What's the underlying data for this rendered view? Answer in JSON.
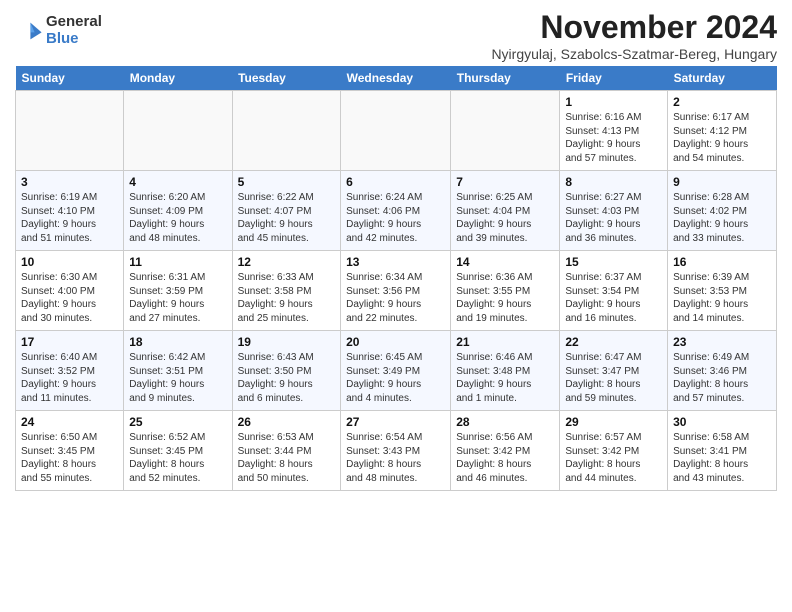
{
  "logo": {
    "general": "General",
    "blue": "Blue"
  },
  "title": "November 2024",
  "location": "Nyirgyulaj, Szabolcs-Szatmar-Bereg, Hungary",
  "headers": [
    "Sunday",
    "Monday",
    "Tuesday",
    "Wednesday",
    "Thursday",
    "Friday",
    "Saturday"
  ],
  "weeks": [
    [
      {
        "day": "",
        "detail": ""
      },
      {
        "day": "",
        "detail": ""
      },
      {
        "day": "",
        "detail": ""
      },
      {
        "day": "",
        "detail": ""
      },
      {
        "day": "",
        "detail": ""
      },
      {
        "day": "1",
        "detail": "Sunrise: 6:16 AM\nSunset: 4:13 PM\nDaylight: 9 hours\nand 57 minutes."
      },
      {
        "day": "2",
        "detail": "Sunrise: 6:17 AM\nSunset: 4:12 PM\nDaylight: 9 hours\nand 54 minutes."
      }
    ],
    [
      {
        "day": "3",
        "detail": "Sunrise: 6:19 AM\nSunset: 4:10 PM\nDaylight: 9 hours\nand 51 minutes."
      },
      {
        "day": "4",
        "detail": "Sunrise: 6:20 AM\nSunset: 4:09 PM\nDaylight: 9 hours\nand 48 minutes."
      },
      {
        "day": "5",
        "detail": "Sunrise: 6:22 AM\nSunset: 4:07 PM\nDaylight: 9 hours\nand 45 minutes."
      },
      {
        "day": "6",
        "detail": "Sunrise: 6:24 AM\nSunset: 4:06 PM\nDaylight: 9 hours\nand 42 minutes."
      },
      {
        "day": "7",
        "detail": "Sunrise: 6:25 AM\nSunset: 4:04 PM\nDaylight: 9 hours\nand 39 minutes."
      },
      {
        "day": "8",
        "detail": "Sunrise: 6:27 AM\nSunset: 4:03 PM\nDaylight: 9 hours\nand 36 minutes."
      },
      {
        "day": "9",
        "detail": "Sunrise: 6:28 AM\nSunset: 4:02 PM\nDaylight: 9 hours\nand 33 minutes."
      }
    ],
    [
      {
        "day": "10",
        "detail": "Sunrise: 6:30 AM\nSunset: 4:00 PM\nDaylight: 9 hours\nand 30 minutes."
      },
      {
        "day": "11",
        "detail": "Sunrise: 6:31 AM\nSunset: 3:59 PM\nDaylight: 9 hours\nand 27 minutes."
      },
      {
        "day": "12",
        "detail": "Sunrise: 6:33 AM\nSunset: 3:58 PM\nDaylight: 9 hours\nand 25 minutes."
      },
      {
        "day": "13",
        "detail": "Sunrise: 6:34 AM\nSunset: 3:56 PM\nDaylight: 9 hours\nand 22 minutes."
      },
      {
        "day": "14",
        "detail": "Sunrise: 6:36 AM\nSunset: 3:55 PM\nDaylight: 9 hours\nand 19 minutes."
      },
      {
        "day": "15",
        "detail": "Sunrise: 6:37 AM\nSunset: 3:54 PM\nDaylight: 9 hours\nand 16 minutes."
      },
      {
        "day": "16",
        "detail": "Sunrise: 6:39 AM\nSunset: 3:53 PM\nDaylight: 9 hours\nand 14 minutes."
      }
    ],
    [
      {
        "day": "17",
        "detail": "Sunrise: 6:40 AM\nSunset: 3:52 PM\nDaylight: 9 hours\nand 11 minutes."
      },
      {
        "day": "18",
        "detail": "Sunrise: 6:42 AM\nSunset: 3:51 PM\nDaylight: 9 hours\nand 9 minutes."
      },
      {
        "day": "19",
        "detail": "Sunrise: 6:43 AM\nSunset: 3:50 PM\nDaylight: 9 hours\nand 6 minutes."
      },
      {
        "day": "20",
        "detail": "Sunrise: 6:45 AM\nSunset: 3:49 PM\nDaylight: 9 hours\nand 4 minutes."
      },
      {
        "day": "21",
        "detail": "Sunrise: 6:46 AM\nSunset: 3:48 PM\nDaylight: 9 hours\nand 1 minute."
      },
      {
        "day": "22",
        "detail": "Sunrise: 6:47 AM\nSunset: 3:47 PM\nDaylight: 8 hours\nand 59 minutes."
      },
      {
        "day": "23",
        "detail": "Sunrise: 6:49 AM\nSunset: 3:46 PM\nDaylight: 8 hours\nand 57 minutes."
      }
    ],
    [
      {
        "day": "24",
        "detail": "Sunrise: 6:50 AM\nSunset: 3:45 PM\nDaylight: 8 hours\nand 55 minutes."
      },
      {
        "day": "25",
        "detail": "Sunrise: 6:52 AM\nSunset: 3:45 PM\nDaylight: 8 hours\nand 52 minutes."
      },
      {
        "day": "26",
        "detail": "Sunrise: 6:53 AM\nSunset: 3:44 PM\nDaylight: 8 hours\nand 50 minutes."
      },
      {
        "day": "27",
        "detail": "Sunrise: 6:54 AM\nSunset: 3:43 PM\nDaylight: 8 hours\nand 48 minutes."
      },
      {
        "day": "28",
        "detail": "Sunrise: 6:56 AM\nSunset: 3:42 PM\nDaylight: 8 hours\nand 46 minutes."
      },
      {
        "day": "29",
        "detail": "Sunrise: 6:57 AM\nSunset: 3:42 PM\nDaylight: 8 hours\nand 44 minutes."
      },
      {
        "day": "30",
        "detail": "Sunrise: 6:58 AM\nSunset: 3:41 PM\nDaylight: 8 hours\nand 43 minutes."
      }
    ]
  ]
}
